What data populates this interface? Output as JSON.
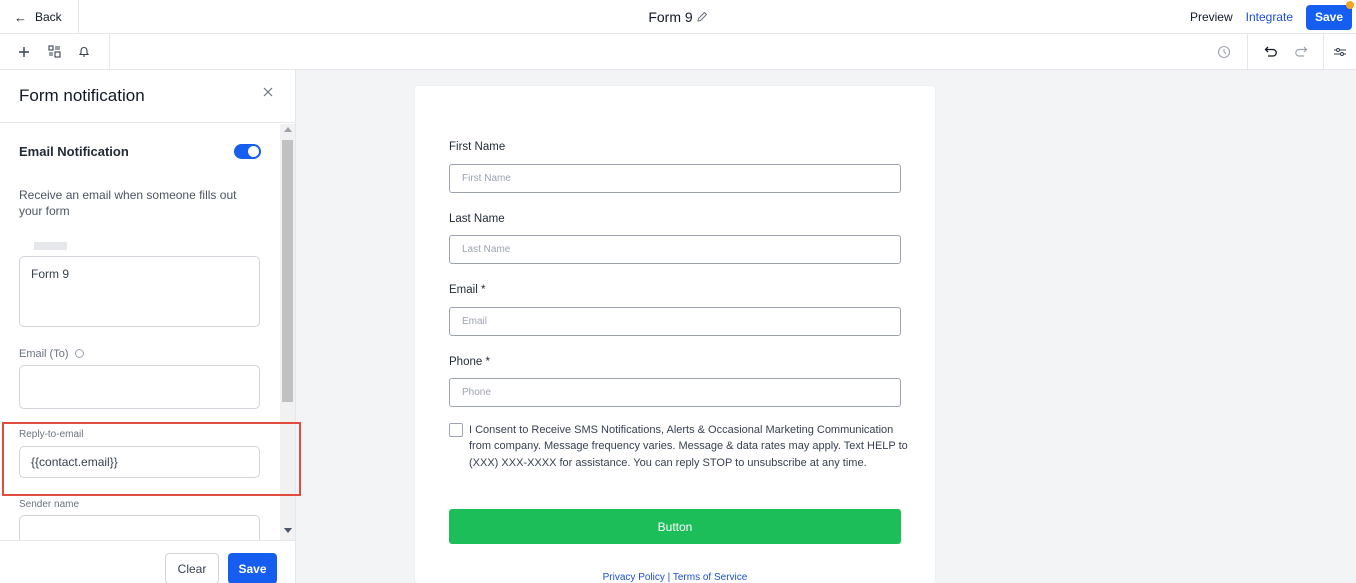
{
  "header": {
    "back_label": "Back",
    "form_title": "Form 9",
    "preview_label": "Preview",
    "integrate_label": "Integrate",
    "save_label": "Save"
  },
  "toolbar": {
    "icons": [
      "plus-icon",
      "layers-icon",
      "bell-icon",
      "history-icon",
      "undo-icon",
      "redo-icon",
      "settings-icon"
    ]
  },
  "panel": {
    "title": "Form notification",
    "email_notification_label": "Email Notification",
    "email_notification_enabled": true,
    "description": "Receive an email when someone fills out your form",
    "subject_value": "Form 9",
    "email_to_label": "Email (To)",
    "email_to_value": "",
    "reply_to_label": "Reply-to-email",
    "reply_to_value": "{{contact.email}}",
    "sender_name_label": "Sender name",
    "sender_name_value": "",
    "clear_label": "Clear",
    "save_label": "Save"
  },
  "form": {
    "fields": [
      {
        "label": "First Name",
        "placeholder": "First Name"
      },
      {
        "label": "Last Name",
        "placeholder": "Last Name"
      },
      {
        "label": "Email *",
        "placeholder": "Email"
      },
      {
        "label": "Phone *",
        "placeholder": "Phone"
      }
    ],
    "consent_text": "I Consent to Receive SMS Notifications, Alerts & Occasional Marketing Communication from company. Message frequency varies. Message & data rates may apply. Text HELP to (XXX) XXX-XXXX for assistance. You can reply STOP to unsubscribe at any time.",
    "button_label": "Button",
    "privacy_label": "Privacy Policy",
    "separator": " | ",
    "terms_label": "Terms of Service"
  },
  "colors": {
    "primary": "#155eef",
    "button_green": "#1cbe5a",
    "highlight_red": "#e24b3f",
    "canvas_bg": "#f3f4f6"
  }
}
